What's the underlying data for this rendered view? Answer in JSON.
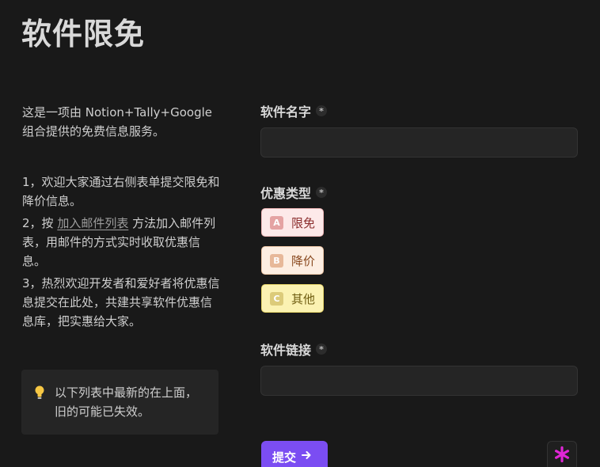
{
  "page": {
    "title": "软件限免"
  },
  "left": {
    "intro": "这是一项由 Notion+Tally+Google 组合提供的免费信息服务。",
    "item1": "1，欢迎大家通过右侧表单提交限免和降价信息。",
    "item2_prefix": "2，按 ",
    "item2_link": "加入邮件列表",
    "item2_suffix": " 方法加入邮件列表，用邮件的方式实时收取优惠信息。",
    "item3": "3，热烈欢迎开发者和爱好者将优惠信息提交在此处，共建共享软件优惠信息库，把实惠给大家。",
    "callout": "以下列表中最新的在上面，旧的可能已失效。"
  },
  "form": {
    "name_label": "软件名字",
    "name_value": "",
    "type_label": "优惠类型",
    "options": [
      {
        "key": "A",
        "label": "限免",
        "color": "#fde9e9"
      },
      {
        "key": "B",
        "label": "降价",
        "color": "#fdeee2"
      },
      {
        "key": "C",
        "label": "其他",
        "color": "#fbf2b2"
      }
    ],
    "link_label": "软件链接",
    "link_value": "",
    "required_mark": "*",
    "submit_label": "提交",
    "accent_color": "#7b4df2"
  },
  "badge": {
    "glyph": "*",
    "color": "#e026d6"
  },
  "icons": {
    "callout": "lightbulb-icon",
    "submit": "arrow-right-icon"
  }
}
